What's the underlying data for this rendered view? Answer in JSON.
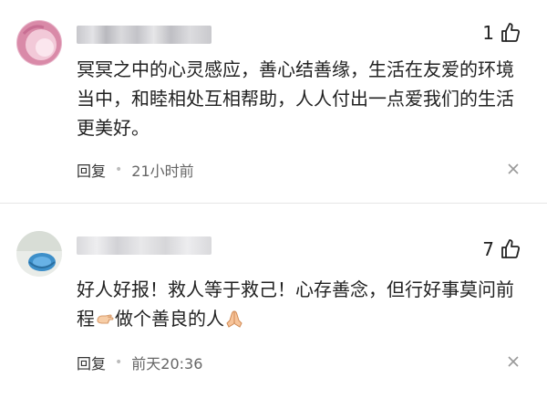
{
  "comments": [
    {
      "likes": "1",
      "text": "冥冥之中的心灵感应，善心结善缘，生活在友爱的环境当中，和睦相处互相帮助，人人付出一点爱我们的生活更美好。",
      "reply_label": "回复",
      "time": "21小时前",
      "icons": {
        "like": "thumbs-up-icon",
        "more": "close-icon",
        "avatar": "avatar-pink"
      }
    },
    {
      "likes": "7",
      "text_part1": "好人好报！救人等于救己！心存善念，但行好事莫问前程",
      "text_part2": "做个善良的人",
      "reply_label": "回复",
      "time": "前天20:36",
      "icons": {
        "like": "thumbs-up-icon",
        "more": "close-icon",
        "avatar": "avatar-blue",
        "emoji1": "pointing-hand-emoji",
        "emoji2": "praying-hands-emoji"
      }
    }
  ],
  "colors": {
    "text": "#222222",
    "meta": "#666666",
    "divider": "#e6e6e6"
  }
}
